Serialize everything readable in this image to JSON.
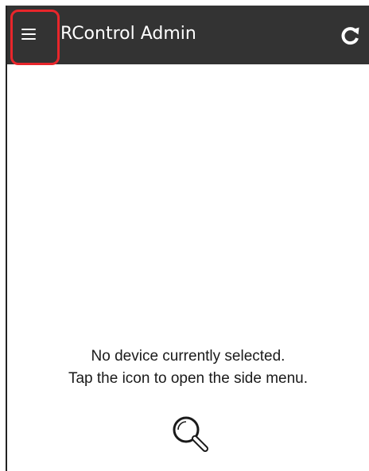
{
  "app_bar": {
    "title": "RControl Admin",
    "menu_icon": "hamburger-menu-icon",
    "refresh_icon": "refresh-icon",
    "background_color": "#333333",
    "highlight_color": "#e8262b"
  },
  "content": {
    "message_line1": "No device currently selected.",
    "message_line2": "Tap the icon to open the side menu.",
    "icon": "search-icon"
  }
}
